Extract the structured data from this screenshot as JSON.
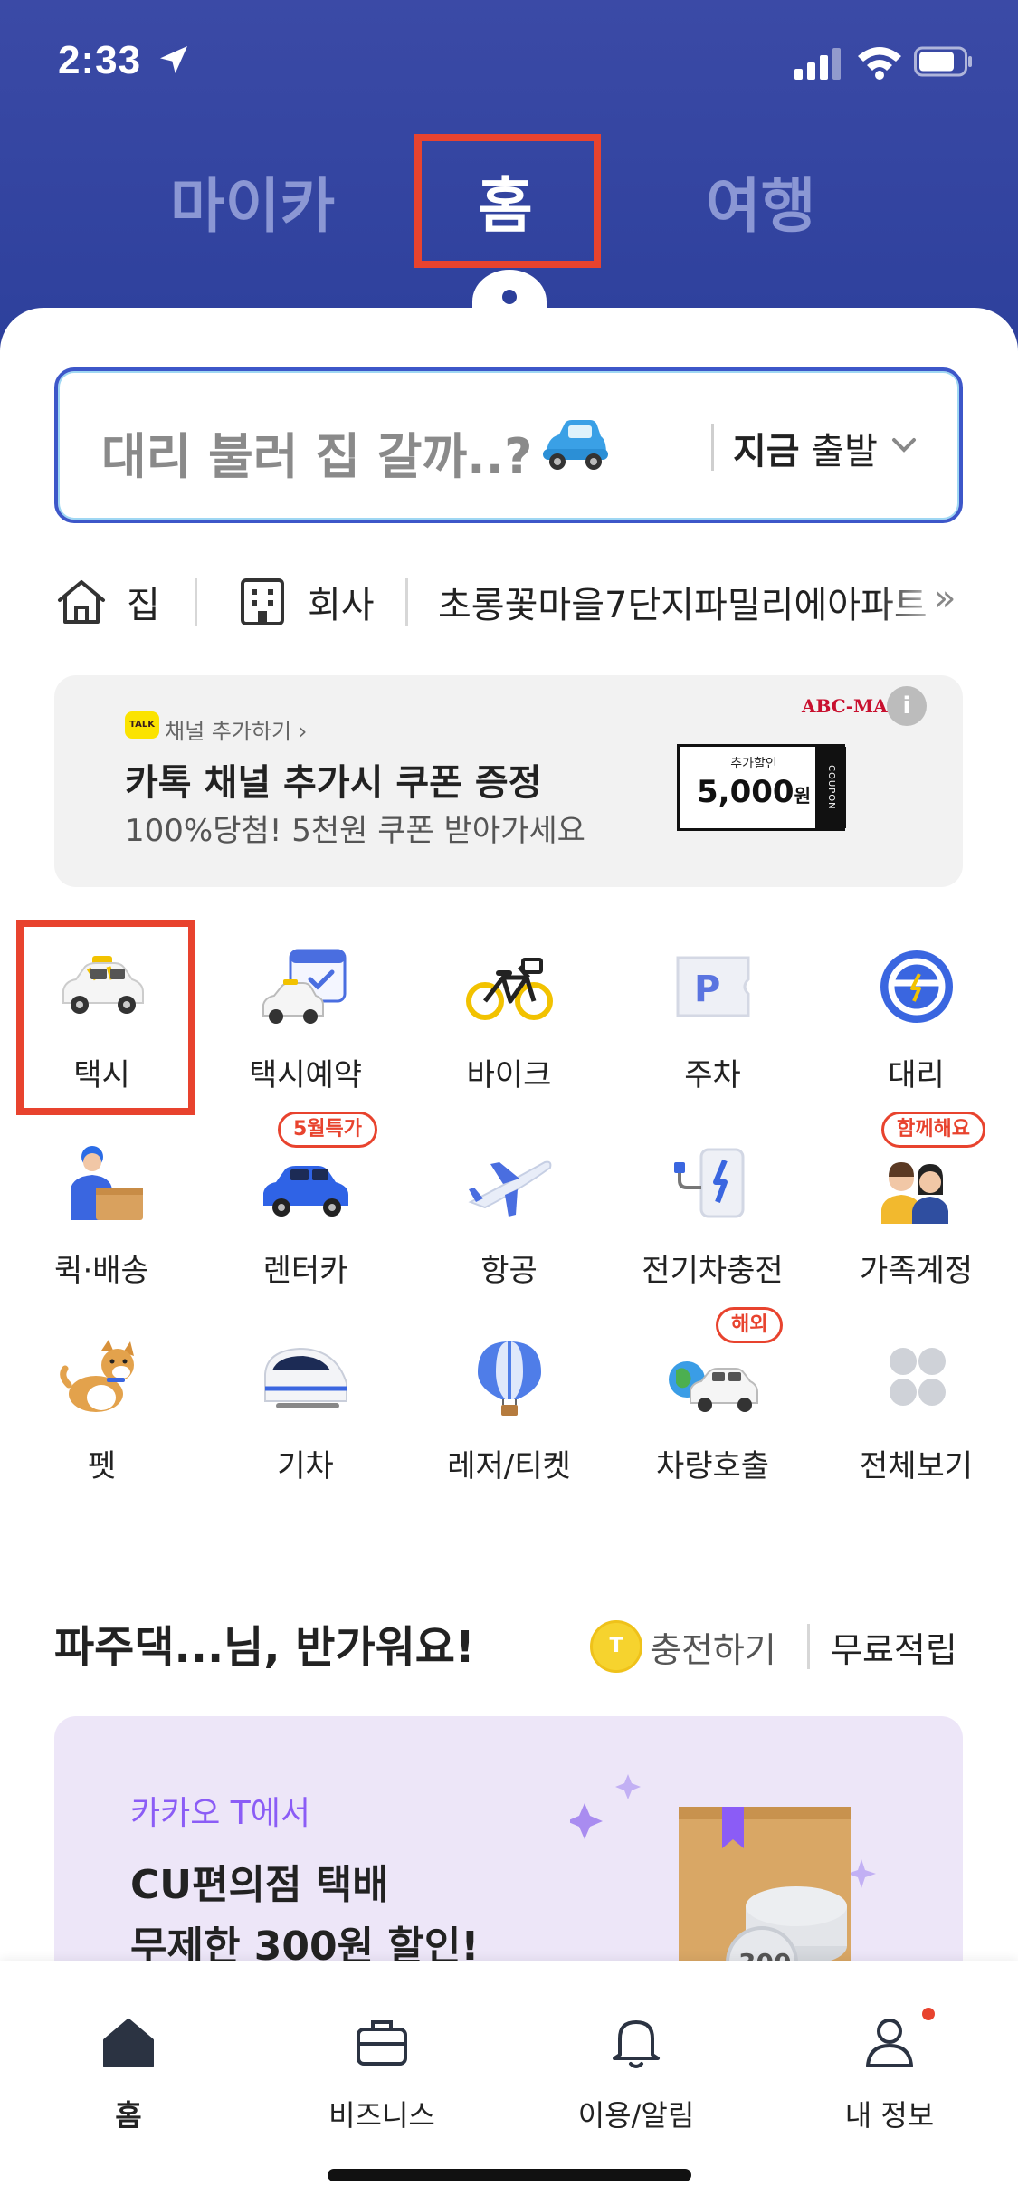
{
  "status_bar": {
    "time": "2:33"
  },
  "top_tabs": [
    {
      "label": "마이카"
    },
    {
      "label": "홈"
    },
    {
      "label": "여행"
    }
  ],
  "search": {
    "placeholder": "대리 불러 집 갈까..?",
    "depart_now": "지금",
    "depart_label": "출발"
  },
  "quick_places": {
    "home": "집",
    "work": "회사",
    "address": "초롱꽃마을7단지파밀리에아파트"
  },
  "banner": {
    "channel_add": "채널 추가하기 ›",
    "title": "카톡 채널 추가시 쿠폰 증정",
    "subtitle": "100%당첨! 5천원 쿠폰 받아가세요",
    "brand": "ABC-MART",
    "coupon_small": "추가할인",
    "coupon_amount": "5,000",
    "coupon_unit": "원",
    "coupon_tag": "COUPON"
  },
  "services": [
    {
      "label": "택시",
      "icon": "taxi-icon"
    },
    {
      "label": "택시예약",
      "icon": "taxi-reservation-icon"
    },
    {
      "label": "바이크",
      "icon": "bike-icon"
    },
    {
      "label": "주차",
      "icon": "parking-icon"
    },
    {
      "label": "대리",
      "icon": "designated-driver-icon"
    },
    {
      "label": "퀵·배송",
      "icon": "delivery-icon"
    },
    {
      "label": "렌터카",
      "icon": "rental-car-icon",
      "badge": "5월특가"
    },
    {
      "label": "항공",
      "icon": "airplane-icon"
    },
    {
      "label": "전기차충전",
      "icon": "ev-charger-icon"
    },
    {
      "label": "가족계정",
      "icon": "family-account-icon",
      "badge": "함께해요"
    },
    {
      "label": "펫",
      "icon": "pet-icon"
    },
    {
      "label": "기차",
      "icon": "train-icon"
    },
    {
      "label": "레저/티켓",
      "icon": "balloon-icon"
    },
    {
      "label": "차량호출",
      "icon": "car-hailing-icon",
      "badge": "해외"
    },
    {
      "label": "전체보기",
      "icon": "all-services-icon"
    }
  ],
  "greeting": {
    "text": "파주댁...님, 반가워요!",
    "coin": "T",
    "charge": "충전하기",
    "free": "무료적립"
  },
  "promo": {
    "kicker": "카카오 T에서",
    "line1": "CU편의점 택배",
    "line2": "무제한 300원 할인!",
    "coin_value": "300"
  },
  "bottom_nav": [
    {
      "label": "홈"
    },
    {
      "label": "비즈니스"
    },
    {
      "label": "이용/알림"
    },
    {
      "label": "내 정보"
    }
  ],
  "colors": {
    "brand_blue": "#2c3f9b",
    "highlight_red": "#e8432e",
    "promo_purple": "#8b5cf6"
  }
}
